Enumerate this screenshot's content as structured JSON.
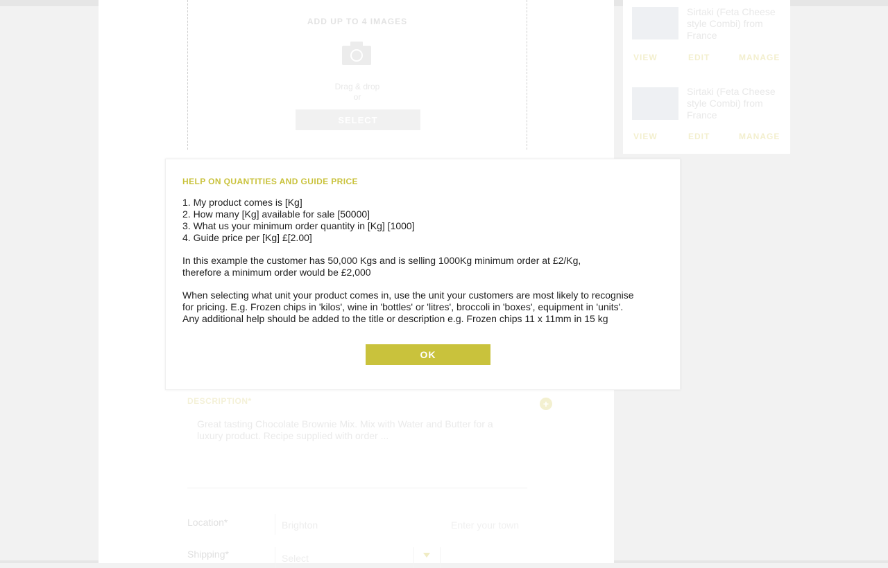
{
  "upload": {
    "heading": "ADD UP TO 4 IMAGES",
    "drag_text": "Drag & drop",
    "or_text": "or",
    "select_label": "SELECT"
  },
  "form": {
    "description_label": "DESCRIPTION*",
    "description_text": "Great tasting Chocolate Brownie Mix. Mix with Water and Butter for a luxury product. Recipe supplied with order ...",
    "location_label": "Location*",
    "location_value": "Brighton",
    "town_placeholder": "Enter your town",
    "shipping_label": "Shipping*",
    "shipping_value": "Select"
  },
  "products": [
    {
      "title": "Sirtaki (Feta Cheese style Combi) from France",
      "view": "VIEW",
      "edit": "EDIT",
      "manage": "MANAGE"
    },
    {
      "title": "Sirtaki (Feta Cheese style Combi) from France",
      "view": "VIEW",
      "edit": "EDIT",
      "manage": "MANAGE"
    }
  ],
  "modal": {
    "title": "HELP ON QUANTITIES AND GUIDE PRICE",
    "line1": "1. My product comes is [Kg]",
    "line2": "2. How many [Kg] available for sale [50000]",
    "line3": "3. What us your minimum order quantity in [Kg] [1000]",
    "line4": "4. Guide price per [Kg] £[2.00]",
    "example1": "In this example the customer has 50,000 Kgs and is selling 1000Kg minimum order at £2/Kg,",
    "example2": "therefore a minimum order would be £2,000",
    "advice1": "When selecting what unit your product comes in, use the unit your customers are most likely to recognise",
    "advice2": "for pricing. E.g. Frozen chips in 'kilos', wine in 'bottles' or 'litres', broccoli in 'boxes', equipment in 'units'.",
    "advice3": "Any additional help should be added to the title or description e.g. Frozen chips 11 x 11mm in 15 kg",
    "ok_label": "OK"
  },
  "colors": {
    "accent": "#c9c23c",
    "backdrop": "#f2f2f2"
  },
  "icons": {
    "camera": "camera-icon",
    "plus": "plus-icon",
    "dropdown": "chevron-down-icon"
  }
}
